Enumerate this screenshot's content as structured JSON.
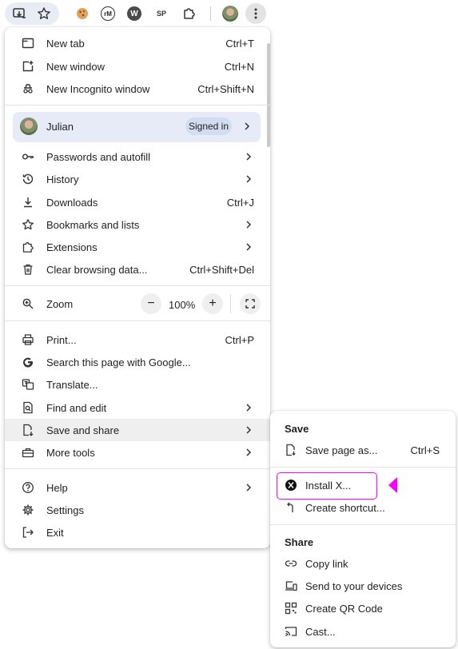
{
  "toolbar": {
    "icons": [
      "install-app-icon",
      "bookmark-star-icon",
      "cookie-extension-icon",
      "rm-extension-icon",
      "w-extension-icon",
      "sp-extension-icon",
      "extensions-puzzle-icon",
      "profile-avatar",
      "menu-kebab-icon"
    ],
    "ext_rm": "rM",
    "ext_w": "W",
    "ext_sp": "SP"
  },
  "menu": {
    "new_tab": {
      "label": "New tab",
      "shortcut": "Ctrl+T"
    },
    "new_window": {
      "label": "New window",
      "shortcut": "Ctrl+N"
    },
    "new_incognito": {
      "label": "New Incognito window",
      "shortcut": "Ctrl+Shift+N"
    },
    "profile": {
      "name": "Julian",
      "status": "Signed in"
    },
    "passwords": {
      "label": "Passwords and autofill"
    },
    "history": {
      "label": "History"
    },
    "downloads": {
      "label": "Downloads",
      "shortcut": "Ctrl+J"
    },
    "bookmarks": {
      "label": "Bookmarks and lists"
    },
    "extensions": {
      "label": "Extensions"
    },
    "clear_data": {
      "label": "Clear browsing data...",
      "shortcut": "Ctrl+Shift+Del"
    },
    "zoom": {
      "label": "Zoom",
      "minus": "−",
      "value": "100%",
      "plus": "+"
    },
    "print": {
      "label": "Print...",
      "shortcut": "Ctrl+P"
    },
    "search_google": {
      "label": "Search this page with Google..."
    },
    "translate": {
      "label": "Translate..."
    },
    "find_edit": {
      "label": "Find and edit"
    },
    "save_share": {
      "label": "Save and share"
    },
    "more_tools": {
      "label": "More tools"
    },
    "help": {
      "label": "Help"
    },
    "settings": {
      "label": "Settings"
    },
    "exit": {
      "label": "Exit"
    }
  },
  "submenu": {
    "save_heading": "Save",
    "save_page": {
      "label": "Save page as...",
      "shortcut": "Ctrl+S"
    },
    "install": {
      "label": "Install X..."
    },
    "create_shortcut": {
      "label": "Create shortcut..."
    },
    "share_heading": "Share",
    "copy_link": {
      "label": "Copy link"
    },
    "send_devices": {
      "label": "Send to your devices"
    },
    "qr_code": {
      "label": "Create QR Code"
    },
    "cast": {
      "label": "Cast..."
    }
  },
  "colors": {
    "highlight": "#ff00ff",
    "profile_bg": "#e6ebf7",
    "hover_bg": "#efefef"
  }
}
